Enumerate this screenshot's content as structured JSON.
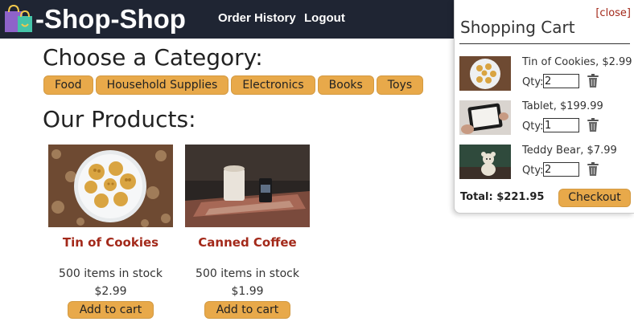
{
  "brand": {
    "name": "-Shop-Shop"
  },
  "nav": {
    "order_history": "Order History",
    "logout": "Logout"
  },
  "categories": {
    "title": "Choose a Category:",
    "items": [
      "Food",
      "Household Supplies",
      "Electronics",
      "Books",
      "Toys"
    ]
  },
  "products": {
    "title": "Our Products:",
    "items": [
      {
        "name": "Tin of Cookies",
        "stock": "500 items in stock",
        "price": "$2.99",
        "button": "Add to cart",
        "image": "cookie-tin-photo"
      },
      {
        "name": "Canned Coffee",
        "stock": "500 items in stock",
        "price": "$1.99",
        "button": "Add to cart",
        "image": "coffee-can-photo"
      }
    ]
  },
  "cart": {
    "close": "[close]",
    "title": "Shopping Cart",
    "qty_label": "Qty:",
    "items": [
      {
        "name": "Tin of Cookies, $2.99",
        "qty": "2",
        "image": "cookie-tin-thumb"
      },
      {
        "name": "Tablet, $199.99",
        "qty": "1",
        "image": "tablet-thumb"
      },
      {
        "name": "Teddy Bear, $7.99",
        "qty": "2",
        "image": "teddy-bear-thumb"
      }
    ],
    "total": "Total: $221.95",
    "checkout": "Checkout"
  },
  "colors": {
    "header_bg": "#1f2533",
    "accent": "#e8a94a",
    "product_name": "#a3291a"
  }
}
